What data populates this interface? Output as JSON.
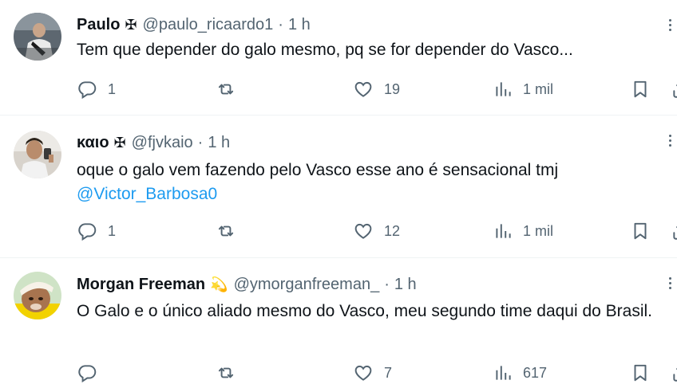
{
  "tweets": [
    {
      "name": "Paulo",
      "badge": "✠",
      "handle": "@paulo_ricaardo1",
      "separator": "·",
      "time": "1 h",
      "text": "Tem que depender do galo mesmo, pq se for depender do Vasco...",
      "mention": "",
      "replies": "1",
      "retweets": "",
      "likes": "19",
      "views": "1 mil"
    },
    {
      "name": "καιο",
      "badge": "✠",
      "handle": "@fjvkaio",
      "separator": "·",
      "time": "1 h",
      "text": "oque o galo vem fazendo pelo Vasco esse ano é sensacional tmj",
      "mention": "@Victor_Barbosa0",
      "replies": "1",
      "retweets": "",
      "likes": "12",
      "views": "1 mil"
    },
    {
      "name": "Morgan Freeman",
      "badge": "💫",
      "handle": "@ymorganfreeman_",
      "separator": "·",
      "time": "1 h",
      "text": "O Galo e o único aliado mesmo do Vasco, meu segundo time daqui do Brasil.",
      "mention": "",
      "replies": "",
      "retweets": "",
      "likes": "7",
      "views": "617"
    }
  ],
  "icons": {
    "reply": "reply-icon",
    "retweet": "retweet-icon",
    "like": "heart-icon",
    "views": "views-icon",
    "bookmark": "bookmark-icon",
    "share": "share-icon",
    "more": "more-icon"
  },
  "colors": {
    "link": "#1d9bf0",
    "secondary_text": "#536471",
    "divider": "#eff3f4"
  }
}
